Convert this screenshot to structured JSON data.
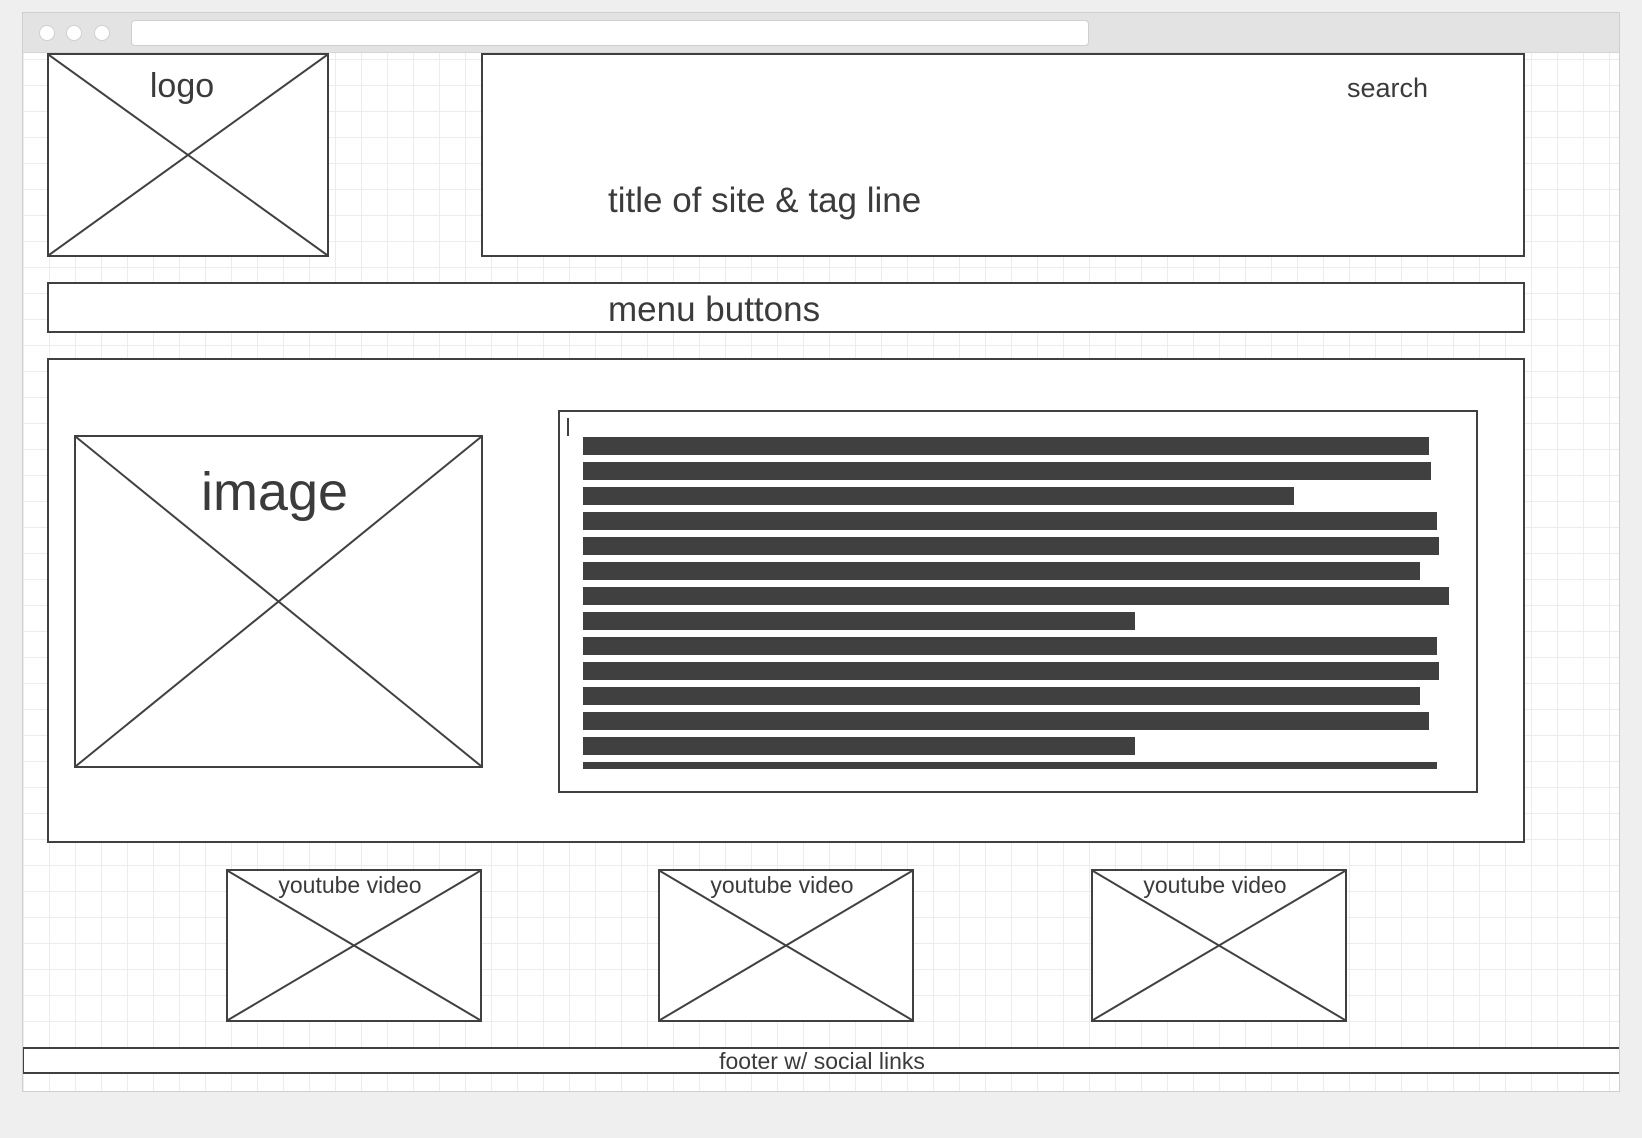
{
  "header": {
    "logo_label": "logo",
    "search_label": "search",
    "title_label": "title of site & tag line"
  },
  "nav": {
    "menu_label": "menu buttons"
  },
  "main": {
    "image_label": "image",
    "text_block": {
      "line_count_visible": 14
    }
  },
  "videos": [
    {
      "label": "youtube video"
    },
    {
      "label": "youtube video"
    },
    {
      "label": "youtube video"
    }
  ],
  "footer": {
    "label": "footer w/ social links"
  },
  "colors": {
    "stroke": "#404040",
    "grid": "#ececec",
    "chrome": "#e3e3e3"
  }
}
